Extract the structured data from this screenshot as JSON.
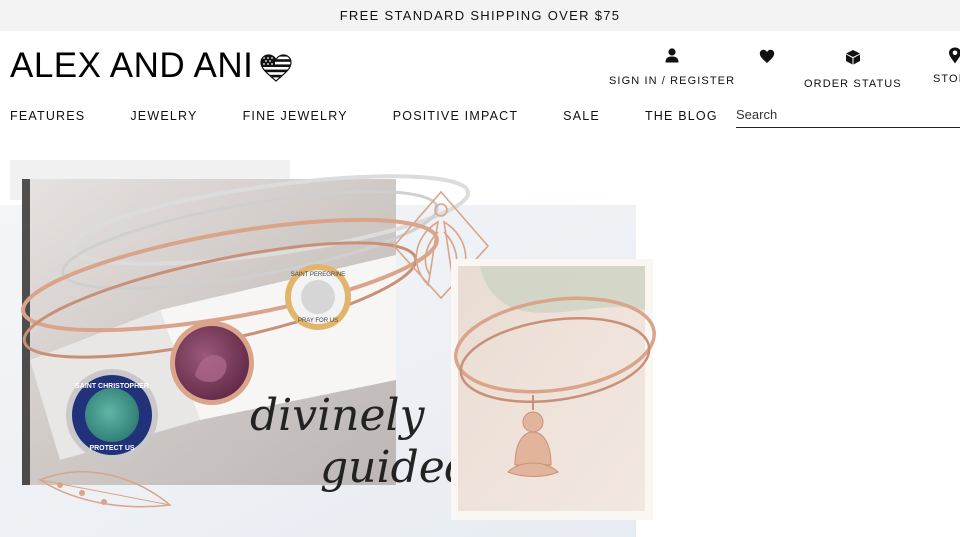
{
  "promo": {
    "text": "FREE STANDARD SHIPPING OVER $75"
  },
  "header": {
    "logo_text": "ALEX AND ANI",
    "utility": [
      {
        "label": "SIGN IN / REGISTER",
        "icon": "user-icon"
      },
      {
        "label": "",
        "icon": "heart-icon"
      },
      {
        "label": "ORDER STATUS",
        "icon": "box-icon"
      },
      {
        "label": "STORES",
        "icon": "location-pin-icon"
      }
    ],
    "search": {
      "placeholder": "Search",
      "value": ""
    }
  },
  "nav": {
    "items": [
      "FEATURES",
      "JEWELRY",
      "FINE JEWELRY",
      "POSITIVE IMPACT",
      "SALE",
      "THE BLOG"
    ]
  },
  "hero": {
    "script_text_1": "divinely",
    "script_text_2": "guided",
    "medal_1_text": "SAINT CHRISTOPHER",
    "medal_1_sub": "PROTECT US",
    "medal_2_text": "SAINT PEREGRINE",
    "medal_2_sub": "PRAY FOR US"
  },
  "colors": {
    "promo_bg": "#f3f3f3",
    "text": "#111111",
    "rose_gold": "#d9a48a",
    "enamel_purple": "#7a3b5a",
    "enamel_teal": "#3a9a8e",
    "enamel_navy": "#22327a"
  }
}
